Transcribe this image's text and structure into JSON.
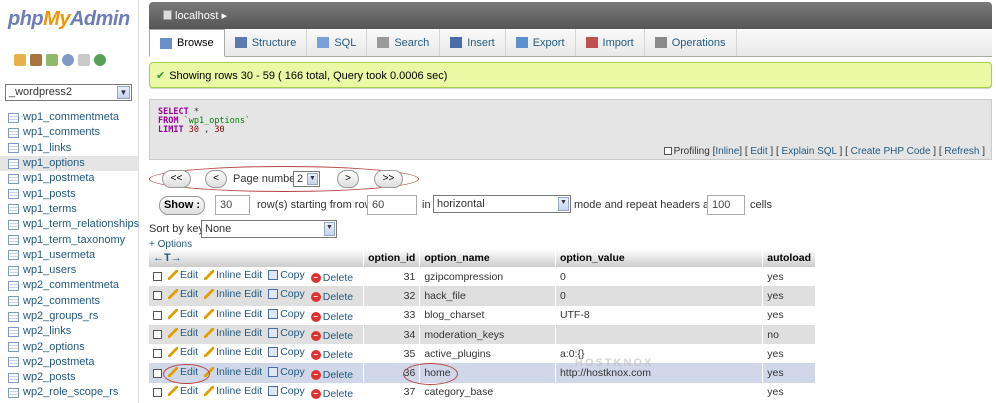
{
  "logo": {
    "part1": "php",
    "part2": "My",
    "part3": "Admin"
  },
  "sidebar": {
    "database": "_wordpress2",
    "tables": [
      {
        "label": "wp1_commentmeta",
        "active": false
      },
      {
        "label": "wp1_comments",
        "active": false
      },
      {
        "label": "wp1_links",
        "active": false
      },
      {
        "label": "wp1_options",
        "active": true
      },
      {
        "label": "wp1_postmeta",
        "active": false
      },
      {
        "label": "wp1_posts",
        "active": false
      },
      {
        "label": "wp1_terms",
        "active": false
      },
      {
        "label": "wp1_term_relationships",
        "active": false
      },
      {
        "label": "wp1_term_taxonomy",
        "active": false
      },
      {
        "label": "wp1_usermeta",
        "active": false
      },
      {
        "label": "wp1_users",
        "active": false
      },
      {
        "label": "wp2_commentmeta",
        "active": false
      },
      {
        "label": "wp2_comments",
        "active": false
      },
      {
        "label": "wp2_groups_rs",
        "active": false
      },
      {
        "label": "wp2_links",
        "active": false
      },
      {
        "label": "wp2_options",
        "active": false
      },
      {
        "label": "wp2_postmeta",
        "active": false
      },
      {
        "label": "wp2_posts",
        "active": false
      },
      {
        "label": "wp2_role_scope_rs",
        "active": false
      }
    ]
  },
  "breadcrumb": {
    "server": "localhost"
  },
  "tabs": [
    {
      "label": "Browse",
      "icon": "browse-icon",
      "active": true
    },
    {
      "label": "Structure",
      "icon": "structure-icon",
      "active": false
    },
    {
      "label": "SQL",
      "icon": "sql-icon",
      "active": false
    },
    {
      "label": "Search",
      "icon": "search-icon",
      "active": false
    },
    {
      "label": "Insert",
      "icon": "insert-icon",
      "active": false
    },
    {
      "label": "Export",
      "icon": "export-icon",
      "active": false
    },
    {
      "label": "Import",
      "icon": "import-icon",
      "active": false
    },
    {
      "label": "Operations",
      "icon": "operations-icon",
      "active": false
    }
  ],
  "message": {
    "text": "Showing rows 30 - 59 ( 166 total, Query took 0.0006 sec)"
  },
  "sql": {
    "kw_select": "SELECT",
    "star": "*",
    "kw_from": "FROM",
    "table": "`wp1_options`",
    "kw_limit": "LIMIT",
    "limit_start": "30",
    "comma": ",",
    "limit_count": "30"
  },
  "sql_links": {
    "profiling": "Profiling",
    "inline": "Inline",
    "edit": "Edit",
    "explain": "Explain SQL",
    "php": "Create PHP Code",
    "refresh": "Refresh"
  },
  "pager": {
    "first": "<<",
    "prev": "<",
    "page_label": "Page number:",
    "page_value": "2",
    "next": ">",
    "last": ">>"
  },
  "show_controls": {
    "show_button": "Show :",
    "rows_value": "30",
    "rows_text": "row(s) starting from row #",
    "start_value": "60",
    "in_text": "in",
    "mode_value": "horizontal",
    "mode_text": "mode and repeat headers after",
    "headers_value": "100",
    "cells_text": "cells"
  },
  "sort": {
    "label": "Sort by key:",
    "value": "None"
  },
  "options_link": "+ Options",
  "table": {
    "arrows": "←T→",
    "columns": [
      "option_id",
      "option_name",
      "option_value",
      "autoload"
    ],
    "actions": {
      "edit": "Edit",
      "inline_edit": "Inline Edit",
      "copy": "Copy",
      "delete": "Delete"
    },
    "rows": [
      {
        "option_id": "31",
        "option_name": "gzipcompression",
        "option_value": "0",
        "autoload": "yes"
      },
      {
        "option_id": "32",
        "option_name": "hack_file",
        "option_value": "0",
        "autoload": "yes"
      },
      {
        "option_id": "33",
        "option_name": "blog_charset",
        "option_value": "UTF-8",
        "autoload": "yes"
      },
      {
        "option_id": "34",
        "option_name": "moderation_keys",
        "option_value": "",
        "autoload": "no"
      },
      {
        "option_id": "35",
        "option_name": "active_plugins",
        "option_value": "a:0:{}",
        "autoload": "yes"
      },
      {
        "option_id": "36",
        "option_name": "home",
        "option_value": "http://hostknox.com",
        "autoload": "yes"
      },
      {
        "option_id": "37",
        "option_name": "category_base",
        "option_value": "",
        "autoload": "yes"
      }
    ]
  },
  "watermark": "HOSTKNOX"
}
